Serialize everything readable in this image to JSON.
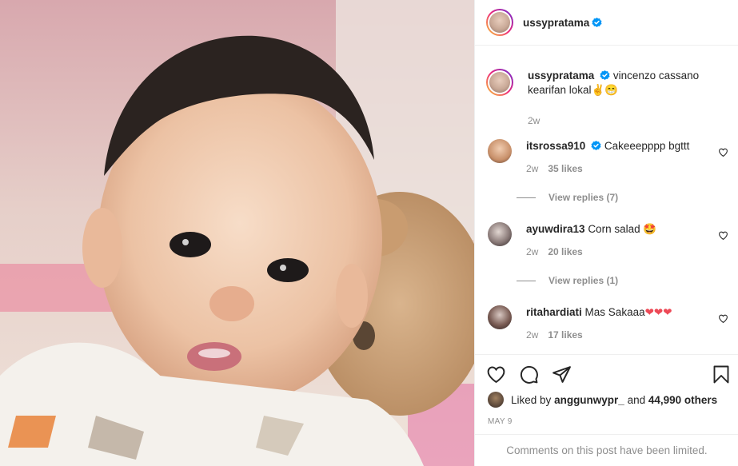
{
  "post": {
    "photo_description_icon": "baby-photo",
    "author": "ussypratama"
  },
  "caption": {
    "username": "ussypratama",
    "text_line1": "vincenzo cassano",
    "text_line2": "kearifan lokal",
    "emoji": "✌😁",
    "time": "2w"
  },
  "comments": [
    {
      "username": "itsrossa910",
      "verified": true,
      "text": "Cakeeepppp bgttt",
      "time": "2w",
      "likes": "35 likes",
      "replies": "View replies (7)"
    },
    {
      "username": "ayuwdira13",
      "verified": false,
      "text": "Corn salad",
      "emoji": "🤩",
      "time": "2w",
      "likes": "20 likes",
      "replies": "View replies (1)"
    },
    {
      "username": "ritahardiati",
      "verified": false,
      "text": "Mas Sakaaa",
      "emoji": "❤❤❤",
      "time": "2w",
      "likes": "17 likes"
    }
  ],
  "likes": {
    "prefix": "Liked by",
    "user": "anggunwypr_",
    "joiner": "and",
    "count": "44,990 others"
  },
  "date": "MAY 9",
  "limited": "Comments on this post have been limited.",
  "colors": {
    "verified": "#0095f6",
    "heart_red": "#ed4956",
    "muted": "#8e8e8e"
  }
}
